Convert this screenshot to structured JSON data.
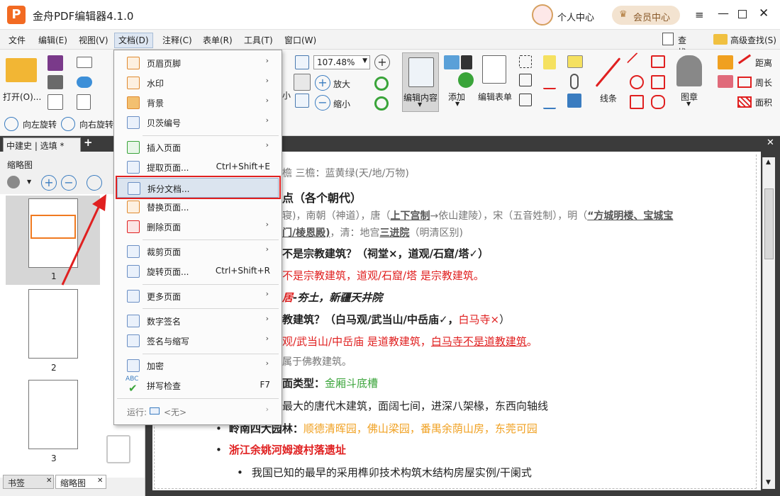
{
  "app": {
    "title": "金舟PDF编辑器4.1.0",
    "personal": "个人中心",
    "member": "会员中心",
    "logo_letter": "P"
  },
  "menu": [
    "文件",
    "编辑(E)",
    "视图(V)",
    "文档(D)",
    "注释(C)",
    "表单(R)",
    "工具(T)",
    "窗口(W)"
  ],
  "toolbar": {
    "open": "打开(O)...",
    "rotate_left": "向左旋转",
    "rotate_right": "向右旋转",
    "zoom_value": "107.48%",
    "zoom_in": "放大",
    "zoom_out": "缩小",
    "small": "小",
    "edit_content": "编辑内容",
    "add": "添加",
    "edit_form": "编辑表单",
    "lines": "线条",
    "stamp": "图章",
    "distance": "距离",
    "perimeter": "周长",
    "area": "面积",
    "find": "查找(F)",
    "advanced_find": "高级查找(S)"
  },
  "tab": {
    "label": "中建史 | 选填 *",
    "add": "+",
    "close": "✕"
  },
  "left": {
    "title": "缩略图",
    "page_labels": [
      "1",
      "2",
      "3"
    ],
    "bottom_tabs": [
      "书签",
      "缩略图"
    ]
  },
  "dropdown": {
    "items": [
      {
        "label": "页眉页脚",
        "shortcut": "",
        "arrow": "›"
      },
      {
        "label": "水印",
        "shortcut": "",
        "arrow": "›"
      },
      {
        "label": "背景",
        "shortcut": "",
        "arrow": "›"
      },
      {
        "label": "贝茨编号",
        "shortcut": "",
        "arrow": "›"
      },
      {
        "label": "插入页面",
        "shortcut": "",
        "arrow": "›"
      },
      {
        "label": "提取页面...",
        "shortcut": "Ctrl+Shift+E",
        "arrow": ""
      },
      {
        "label": "拆分文档...",
        "shortcut": "",
        "arrow": ""
      },
      {
        "label": "替换页面...",
        "shortcut": "",
        "arrow": ""
      },
      {
        "label": "删除页面",
        "shortcut": "",
        "arrow": "›"
      },
      {
        "label": "裁剪页面",
        "shortcut": "",
        "arrow": "›"
      },
      {
        "label": "旋转页面...",
        "shortcut": "Ctrl+Shift+R",
        "arrow": ""
      },
      {
        "label": "更多页面",
        "shortcut": "",
        "arrow": "›"
      },
      {
        "label": "数字签名",
        "shortcut": "",
        "arrow": "›"
      },
      {
        "label": "签名与缩写",
        "shortcut": "",
        "arrow": "›"
      },
      {
        "label": "加密",
        "shortcut": "",
        "arrow": "›"
      },
      {
        "label": "拼写检查",
        "shortcut": "F7",
        "arrow": ""
      }
    ],
    "run_label": "运行:",
    "run_value": "<无>",
    "abc": "ABC"
  },
  "doc_lines": {
    "l0": "檐 三檐：蓝黄绿(天/地/万物)",
    "l1": "点（各个朝代）",
    "l2a": "寝)，南朝（神道），唐（",
    "l2b": "上下宫制",
    "l2c": "→依山建陵），宋（五音姓制），明（",
    "l2d": "“方城明楼、宝城宝",
    "l3a": "门/棱恩殿)",
    "l3b": "，清：地宫",
    "l3c": "三进院",
    "l3d": "（明清区别)",
    "l4": "不是宗教建筑？（祠堂×，道观/石窟/塔✓）",
    "l5": "不是宗教建筑，道观/石窟/塔 是宗教建筑。",
    "l6a": "居",
    "l6b": "-夯土，新疆天井院",
    "l7a": "教建筑？（白马观/武当山/中岳庙✓，",
    "l7b": "白马寺×",
    "l7c": "）",
    "l8a": "观/武当山/中岳庙 是道教建筑，",
    "l8b": "白马寺不是道教建筑",
    "l8c": "。",
    "l9": "属于佛教建筑。",
    "l10a": "面类型：",
    "l10b": "金厢斗底槽",
    "l11": "最大的唐代木建筑，面阔七间，进深八架椽，东西向轴线",
    "l12a": "岭南四大园林：",
    "l12b": "顺德清晖园，佛山梁园，番禺余荫山房，东莞可园",
    "l13": "浙江余姚河姆渡村落遗址",
    "l14": "我国已知的最早的采用榫卯技术构筑木结构房屋实例/干阑式"
  },
  "colors": {
    "accent": "#e02020",
    "highlight_box": "#e02020",
    "menu_active": "#dde6f2",
    "member_bg": "#f3e3d0"
  }
}
